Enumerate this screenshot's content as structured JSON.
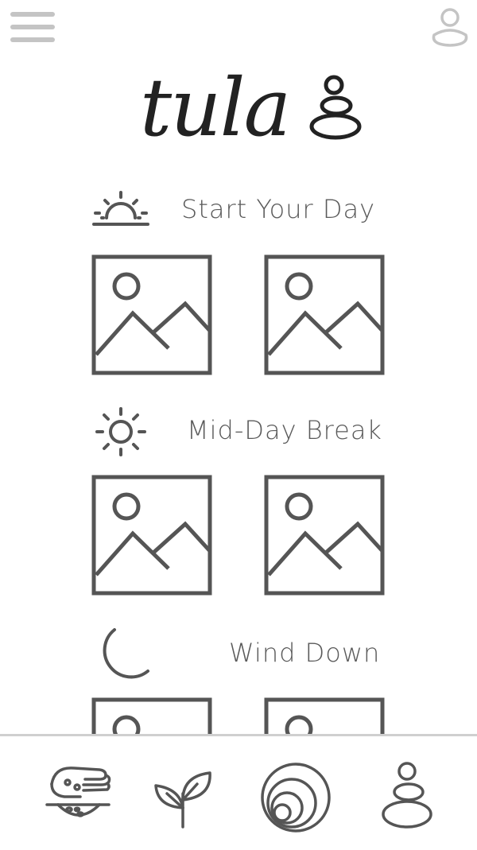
{
  "app": {
    "name": "tula"
  },
  "header": {
    "menu_icon": "hamburger-menu-icon",
    "profile_icon": "profile-avatar-icon",
    "logo_text": "tula",
    "logo_icon": "stacked-stones-icon"
  },
  "sections": [
    {
      "title": "Start Your Day",
      "icon": "sunrise-icon"
    },
    {
      "title": "Mid-Day Break",
      "icon": "sun-icon"
    },
    {
      "title": "Wind Down",
      "icon": "moon-icon"
    }
  ],
  "bottom_nav": [
    {
      "icon": "hand-seeds-icon"
    },
    {
      "icon": "sprout-icon"
    },
    {
      "icon": "concentric-circles-icon"
    },
    {
      "icon": "stacked-stones-icon"
    }
  ],
  "colors": {
    "stroke": "#555555",
    "divider": "#cfcfcf",
    "background": "#ffffff"
  }
}
